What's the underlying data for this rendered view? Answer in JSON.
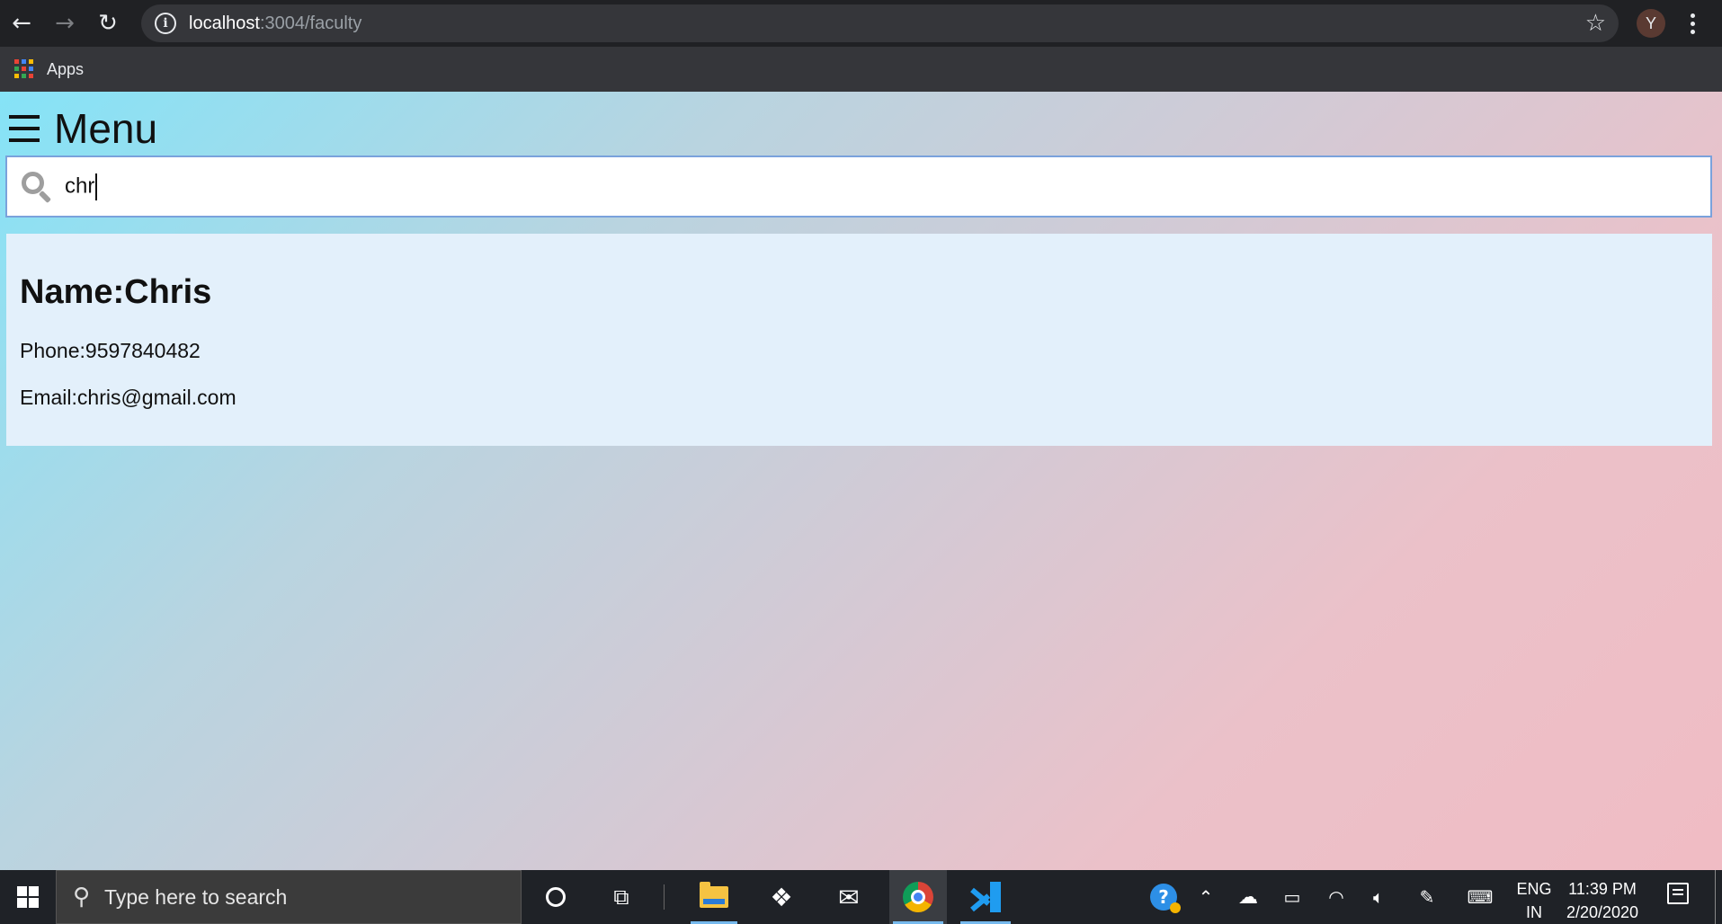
{
  "browser": {
    "back_icon": "←",
    "forward_icon": "→",
    "reload_icon": "↻",
    "info_icon": "i",
    "url_host": "localhost",
    "url_path": ":3004/faculty",
    "star_icon": "☆",
    "profile_initial": "Y",
    "bookmarks": {
      "apps_label": "Apps"
    }
  },
  "page": {
    "menu_title": "Menu",
    "search": {
      "value": "chr"
    },
    "result": {
      "name": "Name:Chris",
      "phone": "Phone:9597840482",
      "email": "Email:chris@gmail.com"
    }
  },
  "taskbar": {
    "search_placeholder": "Type here to search",
    "search_icon": "⚲",
    "help_label": "?",
    "tray_up": "⌃",
    "lang_top": "ENG",
    "lang_bottom": "IN",
    "time": "11:39 PM",
    "date": "2/20/2020"
  },
  "colors": {
    "gradient_start": "#85e3f7",
    "gradient_end": "#f0bcc4",
    "card_bg": "#e3f0fb",
    "chrome_dark": "#202124"
  }
}
